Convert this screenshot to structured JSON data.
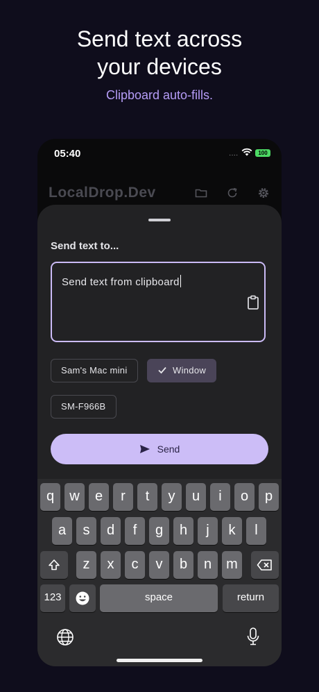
{
  "promo": {
    "headline_line1": "Send text across",
    "headline_line2": "your devices",
    "subline": "Clipboard auto-fills."
  },
  "status_bar": {
    "time": "05:40",
    "battery": "100",
    "signal_dots": "····"
  },
  "app_bar": {
    "title": "LocalDrop.Dev",
    "icons": [
      "folder-icon",
      "refresh-icon",
      "gear-icon"
    ]
  },
  "sheet": {
    "label": "Send text to...",
    "text_value": "Send text from clipboard",
    "clipboard_icon": "clipboard-icon",
    "devices": [
      {
        "name": "Sam's Mac mini",
        "selected": false
      },
      {
        "name": "Window",
        "selected": true
      },
      {
        "name": "SM-F966B",
        "selected": false
      }
    ],
    "send_label": "Send"
  },
  "keyboard": {
    "row1": [
      "q",
      "w",
      "e",
      "r",
      "t",
      "y",
      "u",
      "i",
      "o",
      "p"
    ],
    "row2": [
      "a",
      "s",
      "d",
      "f",
      "g",
      "h",
      "j",
      "k",
      "l"
    ],
    "row3": [
      "z",
      "x",
      "c",
      "v",
      "b",
      "n",
      "m"
    ],
    "numbers_label": "123",
    "space_label": "space",
    "return_label": "return",
    "icons": [
      "shift-icon",
      "backspace-icon",
      "emoji-icon",
      "globe-icon",
      "microphone-icon"
    ]
  },
  "colors": {
    "accent": "#ccbdf7",
    "subline": "#b59cf7",
    "background": "#0f0d1c"
  }
}
